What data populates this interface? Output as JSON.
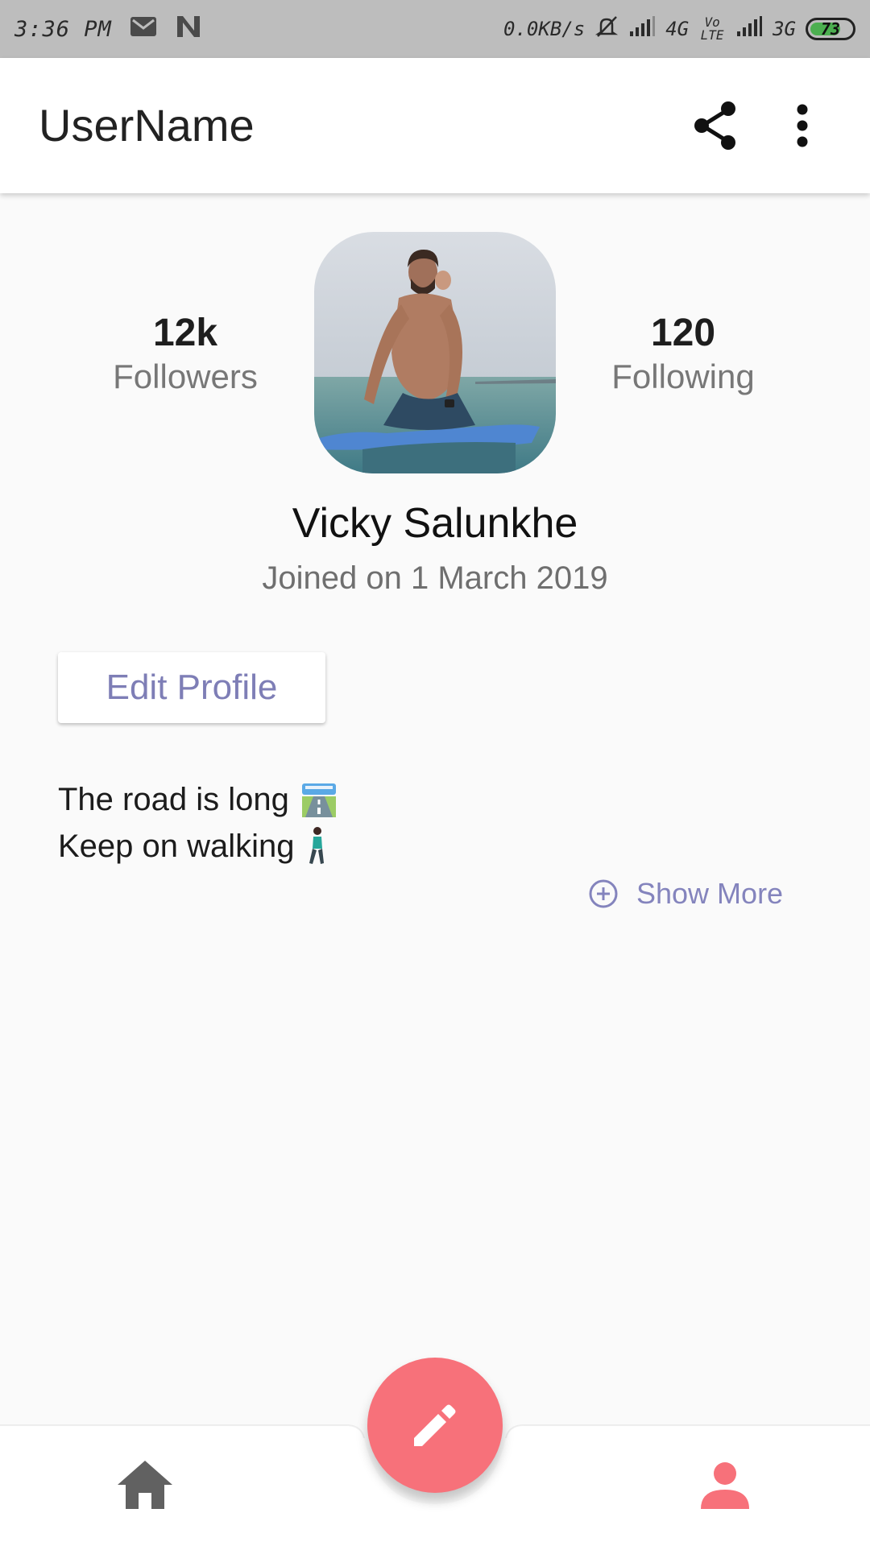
{
  "status_bar": {
    "time": "3:36 PM",
    "speed": "0.0KB/s",
    "net1": "4G",
    "volte": "Vo LTE",
    "net2": "3G",
    "battery": "73",
    "battery_level_percent": 73,
    "icons": [
      "gmail-icon",
      "n-app-icon",
      "mute-icon",
      "signal-icon",
      "signal-icon"
    ]
  },
  "app_bar": {
    "title": "UserName",
    "icons": [
      "share-icon",
      "more-vert-icon"
    ]
  },
  "profile": {
    "followers_count": "12k",
    "followers_label": "Followers",
    "following_count": "120",
    "following_label": "Following",
    "name": "Vicky Salunkhe",
    "joined": "Joined on 1 March 2019",
    "edit_button": "Edit Profile",
    "bio_line1": "The road is long",
    "bio_line2": "Keep on walking",
    "bio_icons": [
      "road-emoji",
      "walking-person-emoji"
    ],
    "show_more": "Show More"
  },
  "bottom_nav": {
    "items": [
      "home-icon",
      "edit-icon",
      "person-icon"
    ]
  },
  "colors": {
    "accent": "#7e7eb6",
    "fab": "#f7717a",
    "status_bar": "#bdbdbd",
    "background": "#fafafa"
  }
}
